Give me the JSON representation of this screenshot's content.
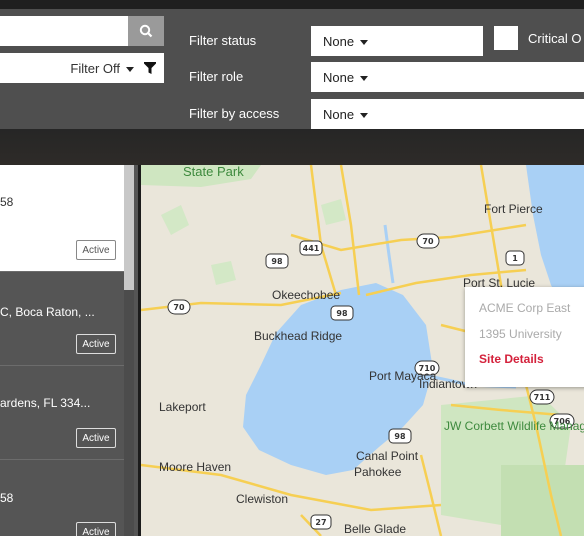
{
  "filters": {
    "filter_toggle_label": "Filter Off",
    "filter_status_label": "Filter status",
    "filter_status_value": "None",
    "filter_role_label": "Filter role",
    "filter_role_value": "None",
    "filter_access_label": "Filter by access",
    "filter_access_value": "None",
    "critical_label": "Critical O"
  },
  "sites": [
    {
      "text": "58",
      "status": "Active"
    },
    {
      "text": "C, Boca Raton, ...",
      "status": "Active"
    },
    {
      "text": "ardens, FL 334...",
      "status": "Active"
    },
    {
      "text": "58",
      "status": "Active"
    }
  ],
  "map": {
    "labels": [
      "State Park",
      "Fort Pierce",
      "Port St. Lucie",
      "Okeechobee",
      "Buckhead Ridge",
      "Indiantown",
      "Port Mayaca",
      "Lakeport",
      "JW Corbett Wildlife Management Area",
      "Moore Haven",
      "Canal Point",
      "Pahokee",
      "Clewiston",
      "Belle Glade"
    ],
    "shields": [
      "441",
      "98",
      "70",
      "1",
      "70",
      "98",
      "710",
      "711",
      "706",
      "98",
      "27"
    ]
  },
  "popup": {
    "name": "ACME Corp East",
    "address": "1395 University",
    "link": "Site Details"
  },
  "colors": {
    "toolbar_bg": "#4f4f4f",
    "list_bg": "#555555",
    "link_red": "#d4213b",
    "map_land": "#eae6da",
    "map_water": "#a9d0f5"
  }
}
